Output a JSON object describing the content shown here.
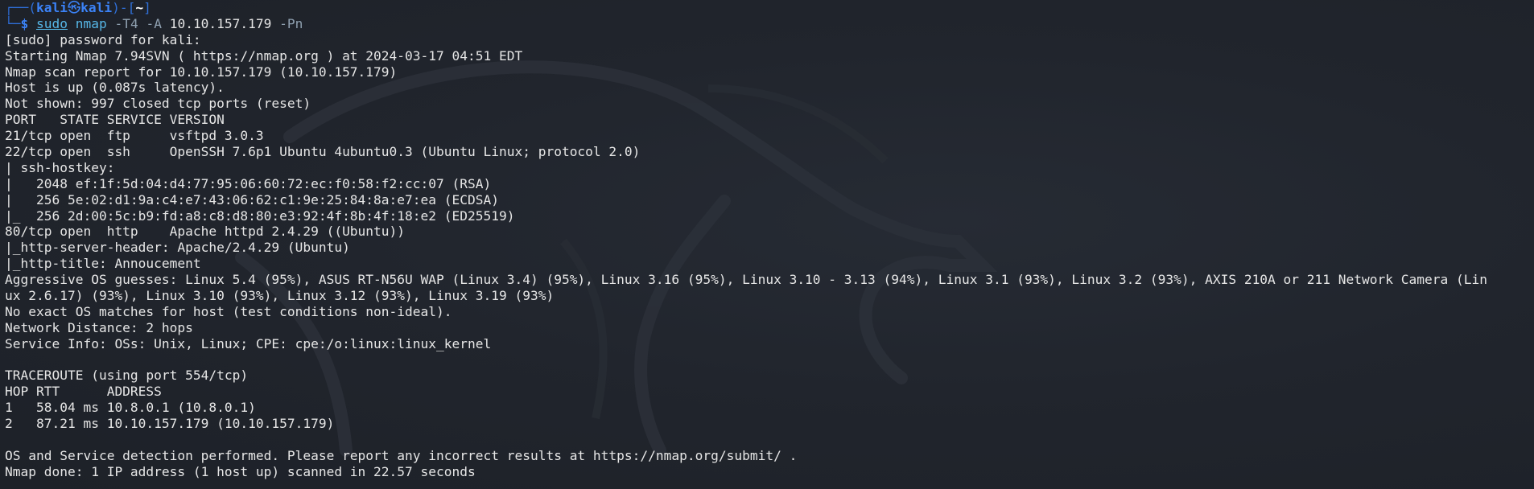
{
  "prompt": {
    "frame_top_left": "┌──(",
    "user": "kali",
    "skull": "㉿",
    "host": "kali",
    "frame_mid": ")-[",
    "dir": "~",
    "frame_end": "]",
    "frame_bottom": "└─",
    "dollar": "$",
    "cmd_sudo": "sudo",
    "cmd_name": "nmap",
    "cmd_flags": "-T4 -A",
    "cmd_target": "10.10.157.179",
    "cmd_pn": "-Pn"
  },
  "output_lines": [
    "[sudo] password for kali: ",
    "Starting Nmap 7.94SVN ( https://nmap.org ) at 2024-03-17 04:51 EDT",
    "Nmap scan report for 10.10.157.179 (10.10.157.179)",
    "Host is up (0.087s latency).",
    "Not shown: 997 closed tcp ports (reset)",
    "PORT   STATE SERVICE VERSION",
    "21/tcp open  ftp     vsftpd 3.0.3",
    "22/tcp open  ssh     OpenSSH 7.6p1 Ubuntu 4ubuntu0.3 (Ubuntu Linux; protocol 2.0)",
    "| ssh-hostkey: ",
    "|   2048 ef:1f:5d:04:d4:77:95:06:60:72:ec:f0:58:f2:cc:07 (RSA)",
    "|   256 5e:02:d1:9a:c4:e7:43:06:62:c1:9e:25:84:8a:e7:ea (ECDSA)",
    "|_  256 2d:00:5c:b9:fd:a8:c8:d8:80:e3:92:4f:8b:4f:18:e2 (ED25519)",
    "80/tcp open  http    Apache httpd 2.4.29 ((Ubuntu))",
    "|_http-server-header: Apache/2.4.29 (Ubuntu)",
    "|_http-title: Annoucement",
    "Aggressive OS guesses: Linux 5.4 (95%), ASUS RT-N56U WAP (Linux 3.4) (95%), Linux 3.16 (95%), Linux 3.10 - 3.13 (94%), Linux 3.1 (93%), Linux 3.2 (93%), AXIS 210A or 211 Network Camera (Lin",
    "ux 2.6.17) (93%), Linux 3.10 (93%), Linux 3.12 (93%), Linux 3.19 (93%)",
    "No exact OS matches for host (test conditions non-ideal).",
    "Network Distance: 2 hops",
    "Service Info: OSs: Unix, Linux; CPE: cpe:/o:linux:linux_kernel",
    "",
    "TRACEROUTE (using port 554/tcp)",
    "HOP RTT      ADDRESS",
    "1   58.04 ms 10.8.0.1 (10.8.0.1)",
    "2   87.21 ms 10.10.157.179 (10.10.157.179)",
    "",
    "OS and Service detection performed. Please report any incorrect results at https://nmap.org/submit/ .",
    "Nmap done: 1 IP address (1 host up) scanned in 22.57 seconds"
  ]
}
